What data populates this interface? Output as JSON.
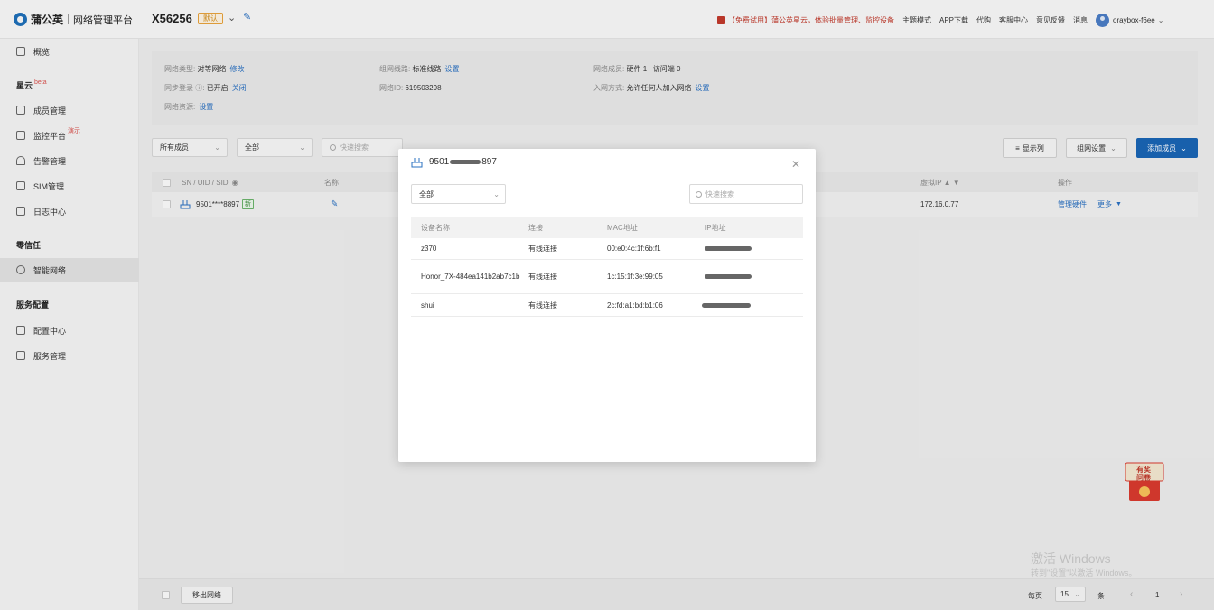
{
  "header": {
    "brand": "蒲公英",
    "platform": "网络管理平台",
    "network_name": "X56256",
    "default_badge": "默认",
    "promo": "【免费试用】蒲公英星云，体验批量管理、监控设备",
    "links": [
      "主题模式",
      "APP下载",
      "代购",
      "客服中心",
      "意见反馈",
      "消息"
    ],
    "user": "oraybox-f6ee"
  },
  "sidebar": {
    "overview": "概览",
    "groups": [
      {
        "title": "星云",
        "tag": "beta",
        "items": [
          {
            "label": "成员管理",
            "icon": "layers-icon"
          },
          {
            "label": "监控平台",
            "icon": "monitor-icon",
            "tag": "演示"
          },
          {
            "label": "告警管理",
            "icon": "bell-icon"
          },
          {
            "label": "SIM管理",
            "icon": "sim-card-icon"
          },
          {
            "label": "日志中心",
            "icon": "calendar-icon"
          }
        ]
      },
      {
        "title": "零信任",
        "items": [
          {
            "label": "智能网络",
            "icon": "network-icon",
            "active": true
          }
        ]
      },
      {
        "title": "服务配置",
        "items": [
          {
            "label": "配置中心",
            "icon": "grid-icon"
          },
          {
            "label": "服务管理",
            "icon": "document-icon"
          }
        ]
      }
    ]
  },
  "info": {
    "type_label": "网络类型:",
    "type_value": "对等网络",
    "type_action": "修改",
    "line_label": "组网线路:",
    "line_value": "标准线路",
    "line_action": "设置",
    "members_label": "网络成员:",
    "members_value": "硬件 1",
    "visitors_value": "访问端 0",
    "sync_label": "同步登录 ⓘ:",
    "sync_value": "已开启",
    "sync_action": "关闭",
    "id_label": "网络ID:",
    "id_value": "619503298",
    "join_label": "入网方式:",
    "join_value": "允许任何人加入网络",
    "join_action": "设置",
    "resource_label": "网络资源:",
    "resource_action": "设置"
  },
  "toolbar": {
    "member_filter": "所有成员",
    "status_filter": "全部",
    "search_placeholder": "快速搜索",
    "display_columns": "显示列",
    "group_settings": "组网设置",
    "add_member": "添加成员"
  },
  "table": {
    "columns": [
      "SN / UID / SID",
      "名称",
      "虚拟IP ▲ ▼",
      "操作"
    ],
    "row": {
      "sn": "9501****8897",
      "new_tag": "新",
      "virtual_ip": "172.16.0.77",
      "action_manage": "管理硬件",
      "action_more": "更多"
    }
  },
  "footer": {
    "exit_button": "移出网络",
    "per_page_label": "每页",
    "per_page_value": "15",
    "unit": "条",
    "page": "1"
  },
  "watermark": {
    "line1": "激活 Windows",
    "line2": "转到\"设置\"以激活 Windows。"
  },
  "redpack": {
    "line1": "有奖",
    "line2": "问卷"
  },
  "modal": {
    "title": "9501",
    "title_suffix": "897",
    "filter": "全部",
    "search_placeholder": "快速搜索",
    "columns": [
      "设备名称",
      "连接",
      "MAC地址",
      "IP地址"
    ],
    "rows": [
      {
        "name": "z370",
        "connection": "有线连接",
        "mac": "00:e0:4c:1f:6b:f1"
      },
      {
        "name": "Honor_7X-484ea141b2ab7c1b",
        "connection": "有线连接",
        "mac": "1c:15:1f:3e:99:05"
      },
      {
        "name": "shui",
        "connection": "有线连接",
        "mac": "2c:fd:a1:bd:b1:06"
      }
    ]
  }
}
